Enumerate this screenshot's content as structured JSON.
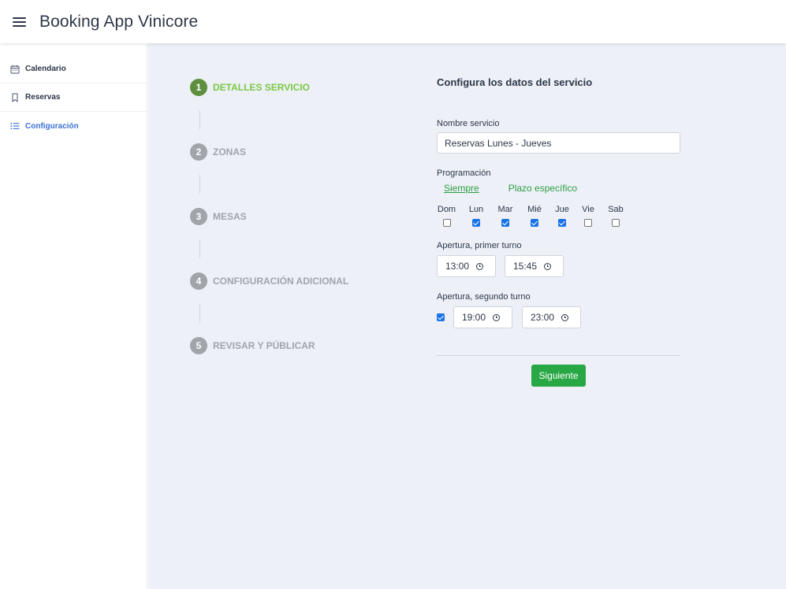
{
  "header": {
    "title": "Booking App Vinicore",
    "menu_icon": "hamburger-icon"
  },
  "sidebar": {
    "items": [
      {
        "label": "Calendario",
        "icon": "calendar-icon"
      },
      {
        "label": "Reservas",
        "icon": "bookmark-icon"
      },
      {
        "label": "Configuración",
        "icon": "list-icon",
        "active": true
      }
    ]
  },
  "stepper": {
    "steps": [
      {
        "number": "1",
        "label": "DETALLES SERVICIO",
        "active": true
      },
      {
        "number": "2",
        "label": "ZONAS"
      },
      {
        "number": "3",
        "label": "MESAS"
      },
      {
        "number": "4",
        "label": "CONFIGURACIÓN ADICIONAL"
      },
      {
        "number": "5",
        "label": "REVISAR Y PÚBLICAR"
      }
    ]
  },
  "form": {
    "title": "Configura los datos del servicio",
    "service_name": {
      "label": "Nombre servicio",
      "value": "Reservas Lunes - Jueves"
    },
    "schedule": {
      "label": "Programación",
      "options": [
        "Siempre",
        "Plazo específico"
      ],
      "selected": "Siempre"
    },
    "days": [
      {
        "label": "Dom",
        "checked": false
      },
      {
        "label": "Lun",
        "checked": true
      },
      {
        "label": "Mar",
        "checked": true
      },
      {
        "label": "Mié",
        "checked": true
      },
      {
        "label": "Jue",
        "checked": true
      },
      {
        "label": "Vie",
        "checked": false
      },
      {
        "label": "Sab",
        "checked": false
      }
    ],
    "first_shift": {
      "label": "Apertura, primer turno",
      "start": "13:00",
      "end": "15:45"
    },
    "second_shift": {
      "label": "Apertura, segundo turno",
      "enabled": true,
      "start": "19:00",
      "end": "23:00"
    },
    "next_button": "Siguiente"
  },
  "colors": {
    "accent_green": "#28a745",
    "step_active": "#5f8f3e",
    "step_active_text": "#7ac943",
    "link_green": "#2e9e44",
    "nav_active": "#3b6fd4",
    "background": "#edf0f7"
  }
}
